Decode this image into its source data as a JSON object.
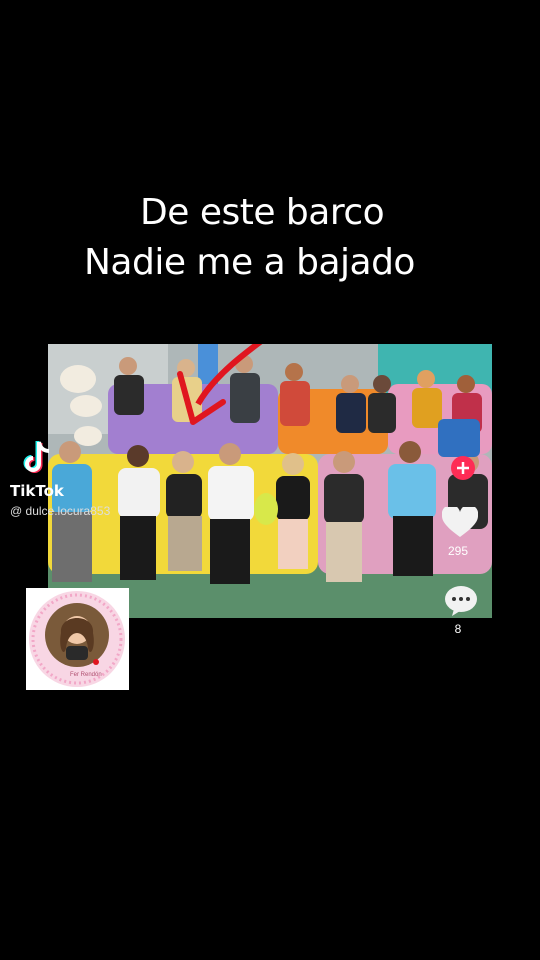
{
  "caption": {
    "line1": "De este barco",
    "line2": "Nadie me a bajado"
  },
  "watermark": {
    "brand": "TikTok",
    "username": "@ dulce.locura853"
  },
  "actions": {
    "likes": "295",
    "comments": "8"
  },
  "sticker": {
    "text": "Fer Rendón"
  },
  "colors": {
    "background": "#000000",
    "arrow": "#e0161f",
    "sofa_yellow": "#f2d93a",
    "sofa_purple": "#a27fd0",
    "sofa_pink": "#e89bc0",
    "sofa_orange": "#f08a2a",
    "sticker_ring": "#f2a7c7"
  }
}
